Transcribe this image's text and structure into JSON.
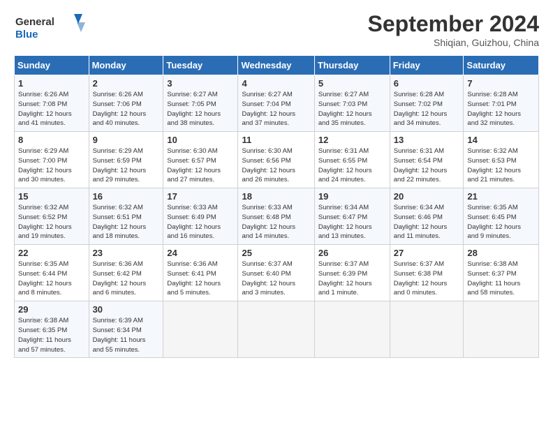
{
  "header": {
    "logo_line1": "General",
    "logo_line2": "Blue",
    "month": "September 2024",
    "location": "Shiqian, Guizhou, China"
  },
  "weekdays": [
    "Sunday",
    "Monday",
    "Tuesday",
    "Wednesday",
    "Thursday",
    "Friday",
    "Saturday"
  ],
  "weeks": [
    [
      {
        "day": "1",
        "info": "Sunrise: 6:26 AM\nSunset: 7:08 PM\nDaylight: 12 hours\nand 41 minutes."
      },
      {
        "day": "2",
        "info": "Sunrise: 6:26 AM\nSunset: 7:06 PM\nDaylight: 12 hours\nand 40 minutes."
      },
      {
        "day": "3",
        "info": "Sunrise: 6:27 AM\nSunset: 7:05 PM\nDaylight: 12 hours\nand 38 minutes."
      },
      {
        "day": "4",
        "info": "Sunrise: 6:27 AM\nSunset: 7:04 PM\nDaylight: 12 hours\nand 37 minutes."
      },
      {
        "day": "5",
        "info": "Sunrise: 6:27 AM\nSunset: 7:03 PM\nDaylight: 12 hours\nand 35 minutes."
      },
      {
        "day": "6",
        "info": "Sunrise: 6:28 AM\nSunset: 7:02 PM\nDaylight: 12 hours\nand 34 minutes."
      },
      {
        "day": "7",
        "info": "Sunrise: 6:28 AM\nSunset: 7:01 PM\nDaylight: 12 hours\nand 32 minutes."
      }
    ],
    [
      {
        "day": "8",
        "info": "Sunrise: 6:29 AM\nSunset: 7:00 PM\nDaylight: 12 hours\nand 30 minutes."
      },
      {
        "day": "9",
        "info": "Sunrise: 6:29 AM\nSunset: 6:59 PM\nDaylight: 12 hours\nand 29 minutes."
      },
      {
        "day": "10",
        "info": "Sunrise: 6:30 AM\nSunset: 6:57 PM\nDaylight: 12 hours\nand 27 minutes."
      },
      {
        "day": "11",
        "info": "Sunrise: 6:30 AM\nSunset: 6:56 PM\nDaylight: 12 hours\nand 26 minutes."
      },
      {
        "day": "12",
        "info": "Sunrise: 6:31 AM\nSunset: 6:55 PM\nDaylight: 12 hours\nand 24 minutes."
      },
      {
        "day": "13",
        "info": "Sunrise: 6:31 AM\nSunset: 6:54 PM\nDaylight: 12 hours\nand 22 minutes."
      },
      {
        "day": "14",
        "info": "Sunrise: 6:32 AM\nSunset: 6:53 PM\nDaylight: 12 hours\nand 21 minutes."
      }
    ],
    [
      {
        "day": "15",
        "info": "Sunrise: 6:32 AM\nSunset: 6:52 PM\nDaylight: 12 hours\nand 19 minutes."
      },
      {
        "day": "16",
        "info": "Sunrise: 6:32 AM\nSunset: 6:51 PM\nDaylight: 12 hours\nand 18 minutes."
      },
      {
        "day": "17",
        "info": "Sunrise: 6:33 AM\nSunset: 6:49 PM\nDaylight: 12 hours\nand 16 minutes."
      },
      {
        "day": "18",
        "info": "Sunrise: 6:33 AM\nSunset: 6:48 PM\nDaylight: 12 hours\nand 14 minutes."
      },
      {
        "day": "19",
        "info": "Sunrise: 6:34 AM\nSunset: 6:47 PM\nDaylight: 12 hours\nand 13 minutes."
      },
      {
        "day": "20",
        "info": "Sunrise: 6:34 AM\nSunset: 6:46 PM\nDaylight: 12 hours\nand 11 minutes."
      },
      {
        "day": "21",
        "info": "Sunrise: 6:35 AM\nSunset: 6:45 PM\nDaylight: 12 hours\nand 9 minutes."
      }
    ],
    [
      {
        "day": "22",
        "info": "Sunrise: 6:35 AM\nSunset: 6:44 PM\nDaylight: 12 hours\nand 8 minutes."
      },
      {
        "day": "23",
        "info": "Sunrise: 6:36 AM\nSunset: 6:42 PM\nDaylight: 12 hours\nand 6 minutes."
      },
      {
        "day": "24",
        "info": "Sunrise: 6:36 AM\nSunset: 6:41 PM\nDaylight: 12 hours\nand 5 minutes."
      },
      {
        "day": "25",
        "info": "Sunrise: 6:37 AM\nSunset: 6:40 PM\nDaylight: 12 hours\nand 3 minutes."
      },
      {
        "day": "26",
        "info": "Sunrise: 6:37 AM\nSunset: 6:39 PM\nDaylight: 12 hours\nand 1 minute."
      },
      {
        "day": "27",
        "info": "Sunrise: 6:37 AM\nSunset: 6:38 PM\nDaylight: 12 hours\nand 0 minutes."
      },
      {
        "day": "28",
        "info": "Sunrise: 6:38 AM\nSunset: 6:37 PM\nDaylight: 11 hours\nand 58 minutes."
      }
    ],
    [
      {
        "day": "29",
        "info": "Sunrise: 6:38 AM\nSunset: 6:35 PM\nDaylight: 11 hours\nand 57 minutes."
      },
      {
        "day": "30",
        "info": "Sunrise: 6:39 AM\nSunset: 6:34 PM\nDaylight: 11 hours\nand 55 minutes."
      },
      {
        "day": "",
        "info": ""
      },
      {
        "day": "",
        "info": ""
      },
      {
        "day": "",
        "info": ""
      },
      {
        "day": "",
        "info": ""
      },
      {
        "day": "",
        "info": ""
      }
    ]
  ]
}
